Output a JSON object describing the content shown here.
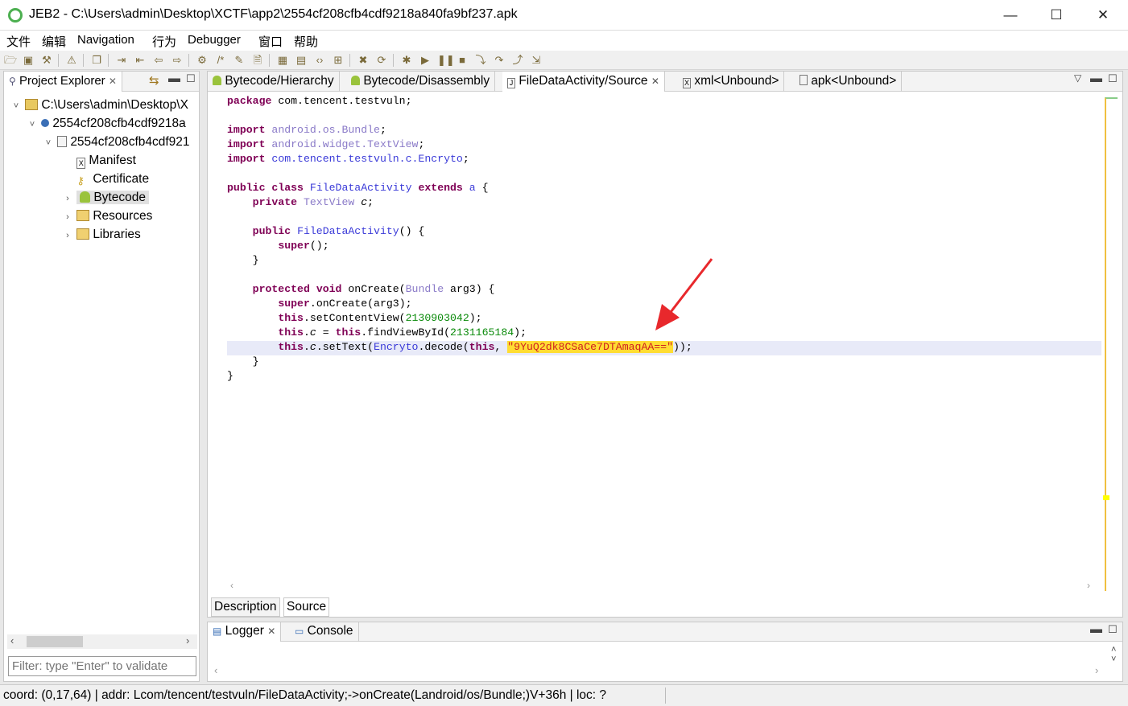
{
  "window": {
    "title": "JEB2 - C:\\Users\\admin\\Desktop\\XCTF\\app2\\2554cf208cfb4cdf9218a840fa9bf237.apk",
    "minimize": "—",
    "maximize": "☐",
    "close": "✕"
  },
  "menu": [
    "文件",
    "编辑",
    "Navigation",
    "行为",
    "Debugger",
    "窗口",
    "帮助"
  ],
  "project_explorer": {
    "tab_label": "Project Explorer",
    "tree": [
      {
        "label": "C:\\Users\\admin\\Desktop\\X",
        "icon": "folder-open-icon",
        "twisty": "˅"
      },
      {
        "label": "2554cf208cfb4cdf9218a",
        "icon": "artifact-dot-icon",
        "twisty": "˅"
      },
      {
        "label": "2554cf208cfb4cdf921",
        "icon": "apk-unit-icon",
        "twisty": "˅"
      },
      {
        "label": "Manifest",
        "icon": "xml-file-icon",
        "twisty": ""
      },
      {
        "label": "Certificate",
        "icon": "key-icon",
        "twisty": ""
      },
      {
        "label": "Bytecode",
        "icon": "android-icon",
        "twisty": "›"
      },
      {
        "label": "Resources",
        "icon": "folder-icon",
        "twisty": "›"
      },
      {
        "label": "Libraries",
        "icon": "folder-icon",
        "twisty": "›"
      }
    ],
    "filter_placeholder": "Filter: type \"Enter\" to validate"
  },
  "editor": {
    "tabs": [
      {
        "label": "Bytecode/Hierarchy",
        "icon": "android-icon"
      },
      {
        "label": "Bytecode/Disassembly",
        "icon": "android-icon"
      },
      {
        "label": "FileDataActivity/Source",
        "icon": "java-file-icon",
        "active": true
      },
      {
        "label": "xml<Unbound>",
        "icon": "xml-file-icon"
      },
      {
        "label": "apk<Unbound>",
        "icon": "apk-unit-icon"
      }
    ],
    "code": {
      "package_kw": "package",
      "package_name": " com.tencent.testvuln;",
      "import_kw": "import",
      "import1": "android.os.Bundle",
      "import2": "android.widget.TextView",
      "import3": "com.tencent.testvuln.c.Encryto",
      "public_kw": "public",
      "class_kw": "class",
      "class_name": "FileDataActivity",
      "extends_kw": "extends",
      "super_class": "a",
      "private_kw": "private",
      "field_type": "TextView",
      "field_name": "c",
      "ctor_name": "FileDataActivity",
      "super_kw": "super",
      "protected_kw": "protected",
      "void_kw": "void",
      "method_name": "onCreate",
      "param_type": "Bundle",
      "param_name": "arg3",
      "this_kw": "this",
      "layout_id": "2130903042",
      "view_id": "2131165184",
      "encryto": "Encryto",
      "encoded_string": "\"9YuQ2dk8CSaCe7DTAmaqAA==\""
    },
    "bottom_tabs": [
      "Description",
      "Source"
    ]
  },
  "logger": {
    "tabs": [
      "Logger",
      "Console"
    ]
  },
  "status": {
    "text": "coord: (0,17,64) | addr: Lcom/tencent/testvuln/FileDataActivity;->onCreate(Landroid/os/Bundle;)V+36h | loc: ?"
  },
  "colors": {
    "keyword": "#7f0055",
    "type": "#8a7ac8",
    "class": "#3a3ad8",
    "number": "#0a8a0a",
    "string_bg": "#ffdd33",
    "string_fg": "#d02020",
    "arrow": "#e8282c"
  }
}
